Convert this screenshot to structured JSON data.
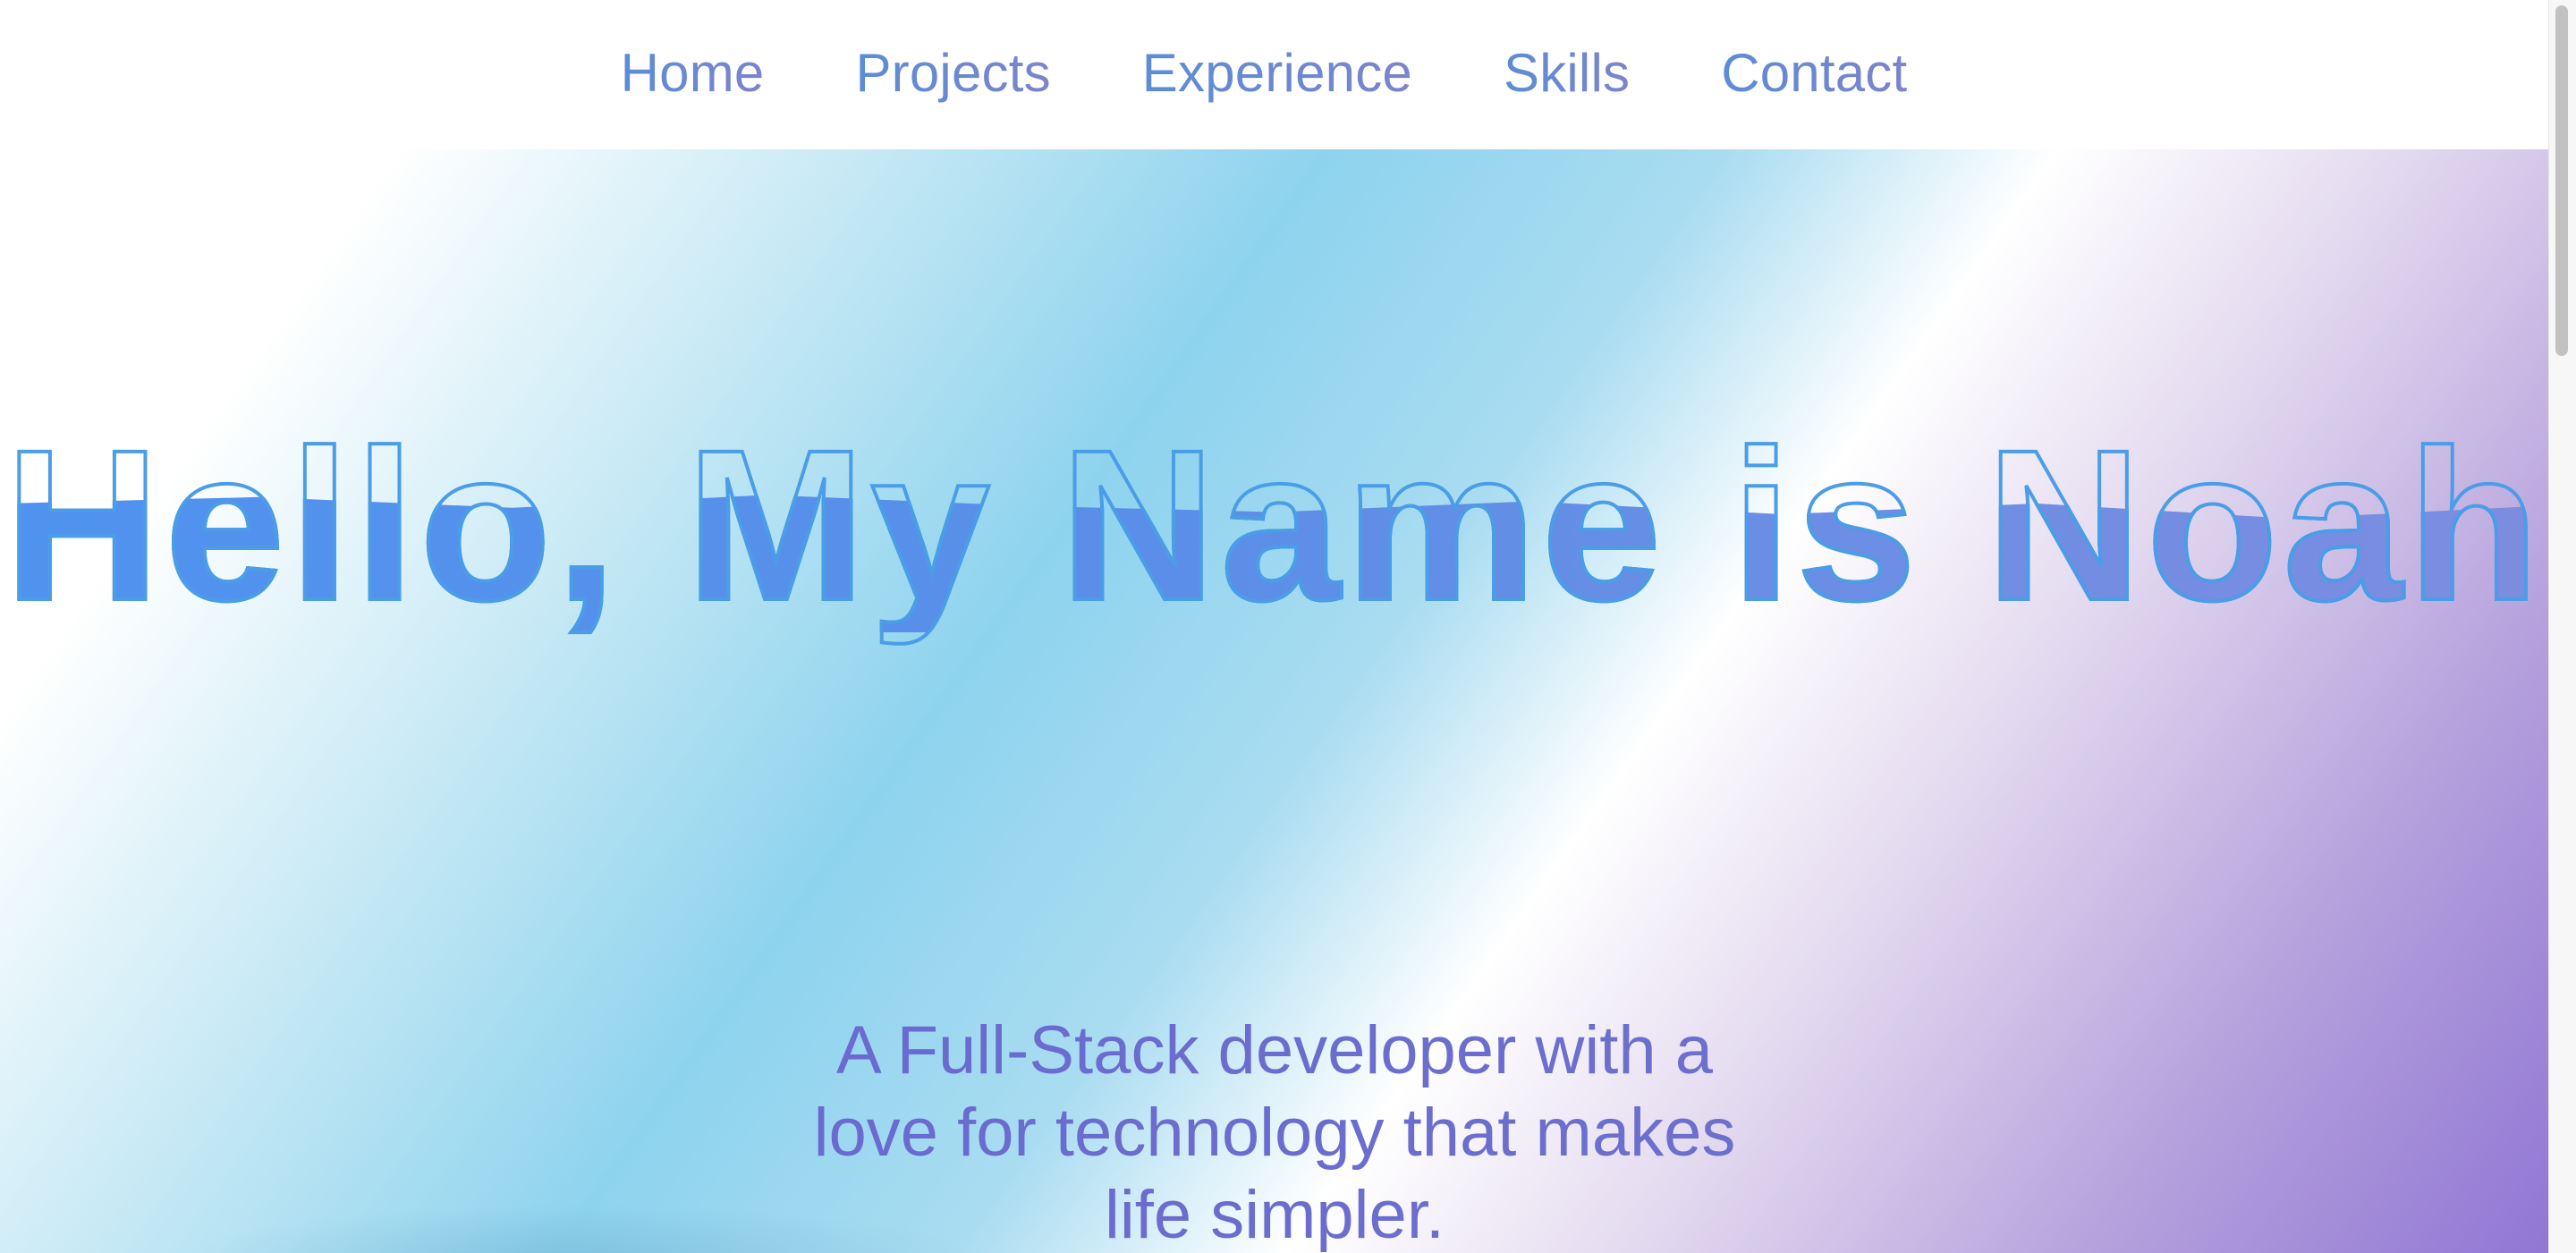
{
  "nav": {
    "items": [
      {
        "label": "Home"
      },
      {
        "label": "Projects"
      },
      {
        "label": "Experience"
      },
      {
        "label": "Skills"
      },
      {
        "label": "Contact"
      }
    ]
  },
  "hero": {
    "title": "Hello, My Name is Noah",
    "subtitle": "A Full-Stack developer with a love for technology that makes life simpler."
  },
  "colors": {
    "nav_text": "#6b84c8",
    "title_fill": "#4f93ef",
    "title_stroke": "#4a9de6",
    "subtitle_text": "#6a6ad0",
    "gradient_blue": "#8ed3ee",
    "gradient_purple": "#9176d4"
  }
}
